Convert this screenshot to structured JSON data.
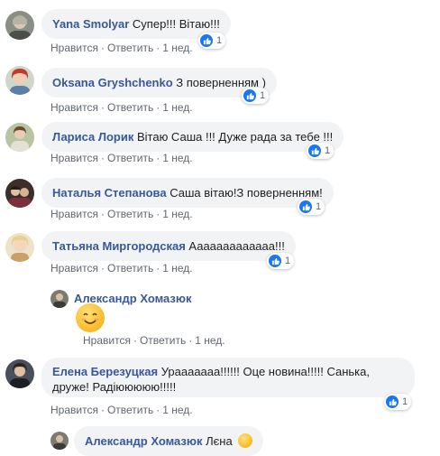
{
  "actions": {
    "like": "Нравится",
    "reply": "Ответить",
    "dot": "·"
  },
  "colors": {
    "author": "#385898",
    "bubble": "#f2f3f5",
    "like": "#1877f2"
  },
  "comments": [
    {
      "author": "Yana Smolyar",
      "text": "Супер!!! Вітаю!!!",
      "time": "1 нед.",
      "likes": "1"
    },
    {
      "author": "Oksana Gryshchenko",
      "text": "З поверненням )",
      "time": "1 нед.",
      "likes": "1"
    },
    {
      "author": "Лариса Лорик",
      "text": "Вітаю Саша !!! Дуже рада за тебе !!!",
      "time": "1 нед.",
      "likes": "1"
    },
    {
      "author": "Наталья Степанова",
      "text": "Саша вітаю!З поверненням!",
      "time": "1 нед.",
      "likes": "1"
    },
    {
      "author": "Татьяна Миргородская",
      "text": "Ааааааааааааа!!!",
      "time": "1 нед.",
      "likes": "1"
    },
    {
      "author": "Александр Хомазюк",
      "text": "",
      "time": "1 нед.",
      "emoji": "smiling-face-emoji"
    },
    {
      "author": "Елена Березуцкая",
      "text_line1": "Урааааааа!!!!!! Оце новина!!!!! Санька,",
      "text_line2": "друже! Радіююююю!!!!!",
      "time": "1 нед.",
      "likes": "1"
    },
    {
      "author": "Александр Хомазюк",
      "text": "Лєна",
      "emoji": "smiling-face-emoji"
    }
  ]
}
